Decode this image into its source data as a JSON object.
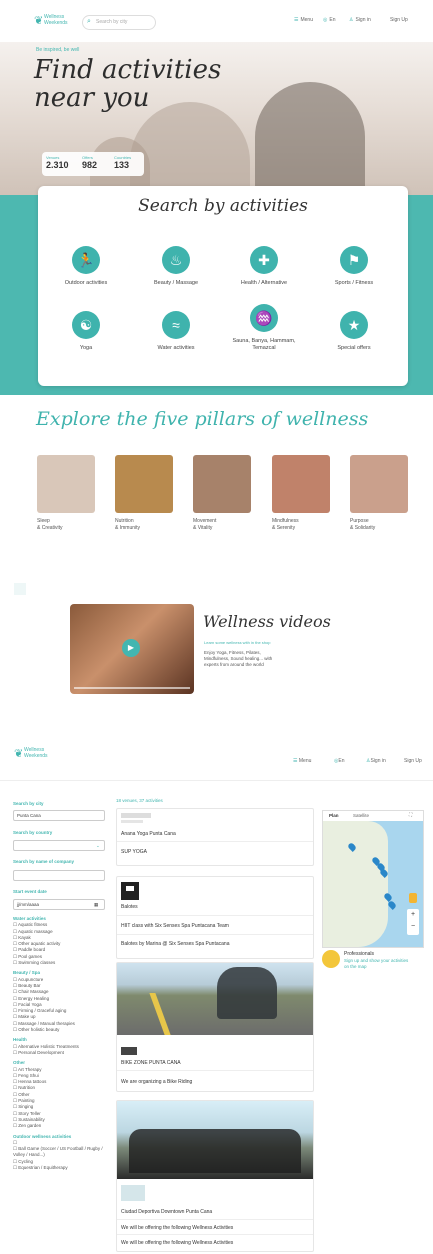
{
  "home": {
    "logo_text": "Wellness Weekends",
    "search_placeholder": "Search by city",
    "nav": {
      "menu": "Menu",
      "lang": "En",
      "signin": "Sign in",
      "signup": "Sign Up"
    },
    "tagline": "Be inspired, be well",
    "hero_title": "Find activities near you",
    "stats": [
      {
        "label": "Venues",
        "value": "2.310"
      },
      {
        "label": "Offers",
        "value": "982"
      },
      {
        "label": "Countries",
        "value": "133"
      }
    ],
    "search_card_title": "Search by activities",
    "activities": [
      {
        "label": "Outdoor activities",
        "icon": "runner-icon"
      },
      {
        "label": "Beauty / Massage",
        "icon": "massage-icon"
      },
      {
        "label": "Health / Alternative",
        "icon": "health-icon"
      },
      {
        "label": "Sports / Fitness",
        "icon": "sport-icon"
      },
      {
        "label": "Yoga",
        "icon": "yoga-icon"
      },
      {
        "label": "Water activities",
        "icon": "swimmer-icon"
      },
      {
        "label": "Sauna, Banya, Hammam, Temazcal",
        "icon": "sauna-icon"
      },
      {
        "label": "Special offers",
        "icon": "offer-icon"
      }
    ],
    "pillars_title": "Explore the five pillars of wellness",
    "pillars": [
      {
        "l1": "Sleep",
        "l2": "& Creativity",
        "color": "#d9c7b9"
      },
      {
        "l1": "Nutrition",
        "l2": "& Immunity",
        "color": "#b88a4e"
      },
      {
        "l1": "Movement",
        "l2": "& Vitality",
        "color": "#a7826a"
      },
      {
        "l1": "Mindfulness",
        "l2": "& Serenity",
        "color": "#c0826a"
      },
      {
        "l1": "Purpose",
        "l2": "& Solidarity",
        "color": "#caa08c"
      }
    ],
    "video_title": "Wellness videos",
    "video_sub": "Learn some wellness with in the shop",
    "video_desc": "Enjoy Yoga, Fitness, Pilates, Mindfulness, Sound healing... with experts from around the world"
  },
  "listing": {
    "logo_text": "Wellness Weekends",
    "nav": {
      "menu": "Menu",
      "lang": "En",
      "signin": "Sign in",
      "signup": "Sign Up"
    },
    "filters": {
      "city_label": "Search by city",
      "city_value": "Punta Cana",
      "country_label": "Search by country",
      "company_label": "Search by name of company",
      "date_label": "Start event date",
      "date_placeholder": "jj/mm/aaaa",
      "groups": [
        {
          "title": "Water activities",
          "items": [
            "Aquatic fitness",
            "Aquatic massage",
            "Kayak",
            "Other aquatic activity",
            "Paddle board",
            "Pool games",
            "Swimming classes"
          ]
        },
        {
          "title": "Beauty / Spa",
          "items": [
            "Acupuncture",
            "Beauty Bar",
            "Chair Massage",
            "Energy Healing",
            "Facial Yoga",
            "Firming / Graceful aging",
            "Make up",
            "Massage / Manual therapies",
            "Other holistic beauty"
          ]
        },
        {
          "title": "Health",
          "items": [
            "Alternative Holistic Treatments",
            "Personal Development"
          ]
        },
        {
          "title": "Other",
          "items": [
            "Art Therapy",
            "Feng Shui",
            "Henna tattoos",
            "Nutrition",
            "Other",
            "Painting",
            "Singing",
            "Story Teller",
            "Sustainability",
            "Zen garden"
          ]
        },
        {
          "title": "Outdoor wellness activities",
          "items": [
            "",
            "Ball Game (Soccer / US Football / Rugby / Volley / Hand...)",
            "Cycling",
            "Equestrian / Equitherapy"
          ]
        }
      ]
    },
    "results_label": "18 venues, 37 activities",
    "listings": [
      {
        "name": "Anana Yoga Punta Cana",
        "line": "SUP YOGA"
      },
      {
        "name": "Balotes",
        "line": "HIIT class with Six Senses Spa Puntacana Team",
        "line2": "Balotes by Marina @ Six Senses Spa Puntacana"
      },
      {
        "name": "BIKE ZONE PUNTA CANA",
        "line": "We are organizing a Bike Riding"
      },
      {
        "name": "Ciudad Deportiva Downtown Punta Cana",
        "line": "We will be offering the following Wellness Activities",
        "line2": "We will be offering the following Wellness Activities"
      }
    ],
    "map": {
      "plan": "Plan",
      "satellite": "Satellite"
    },
    "professionals": {
      "title": "Professionals",
      "cta": "Sign up and show your activities on the map"
    }
  }
}
